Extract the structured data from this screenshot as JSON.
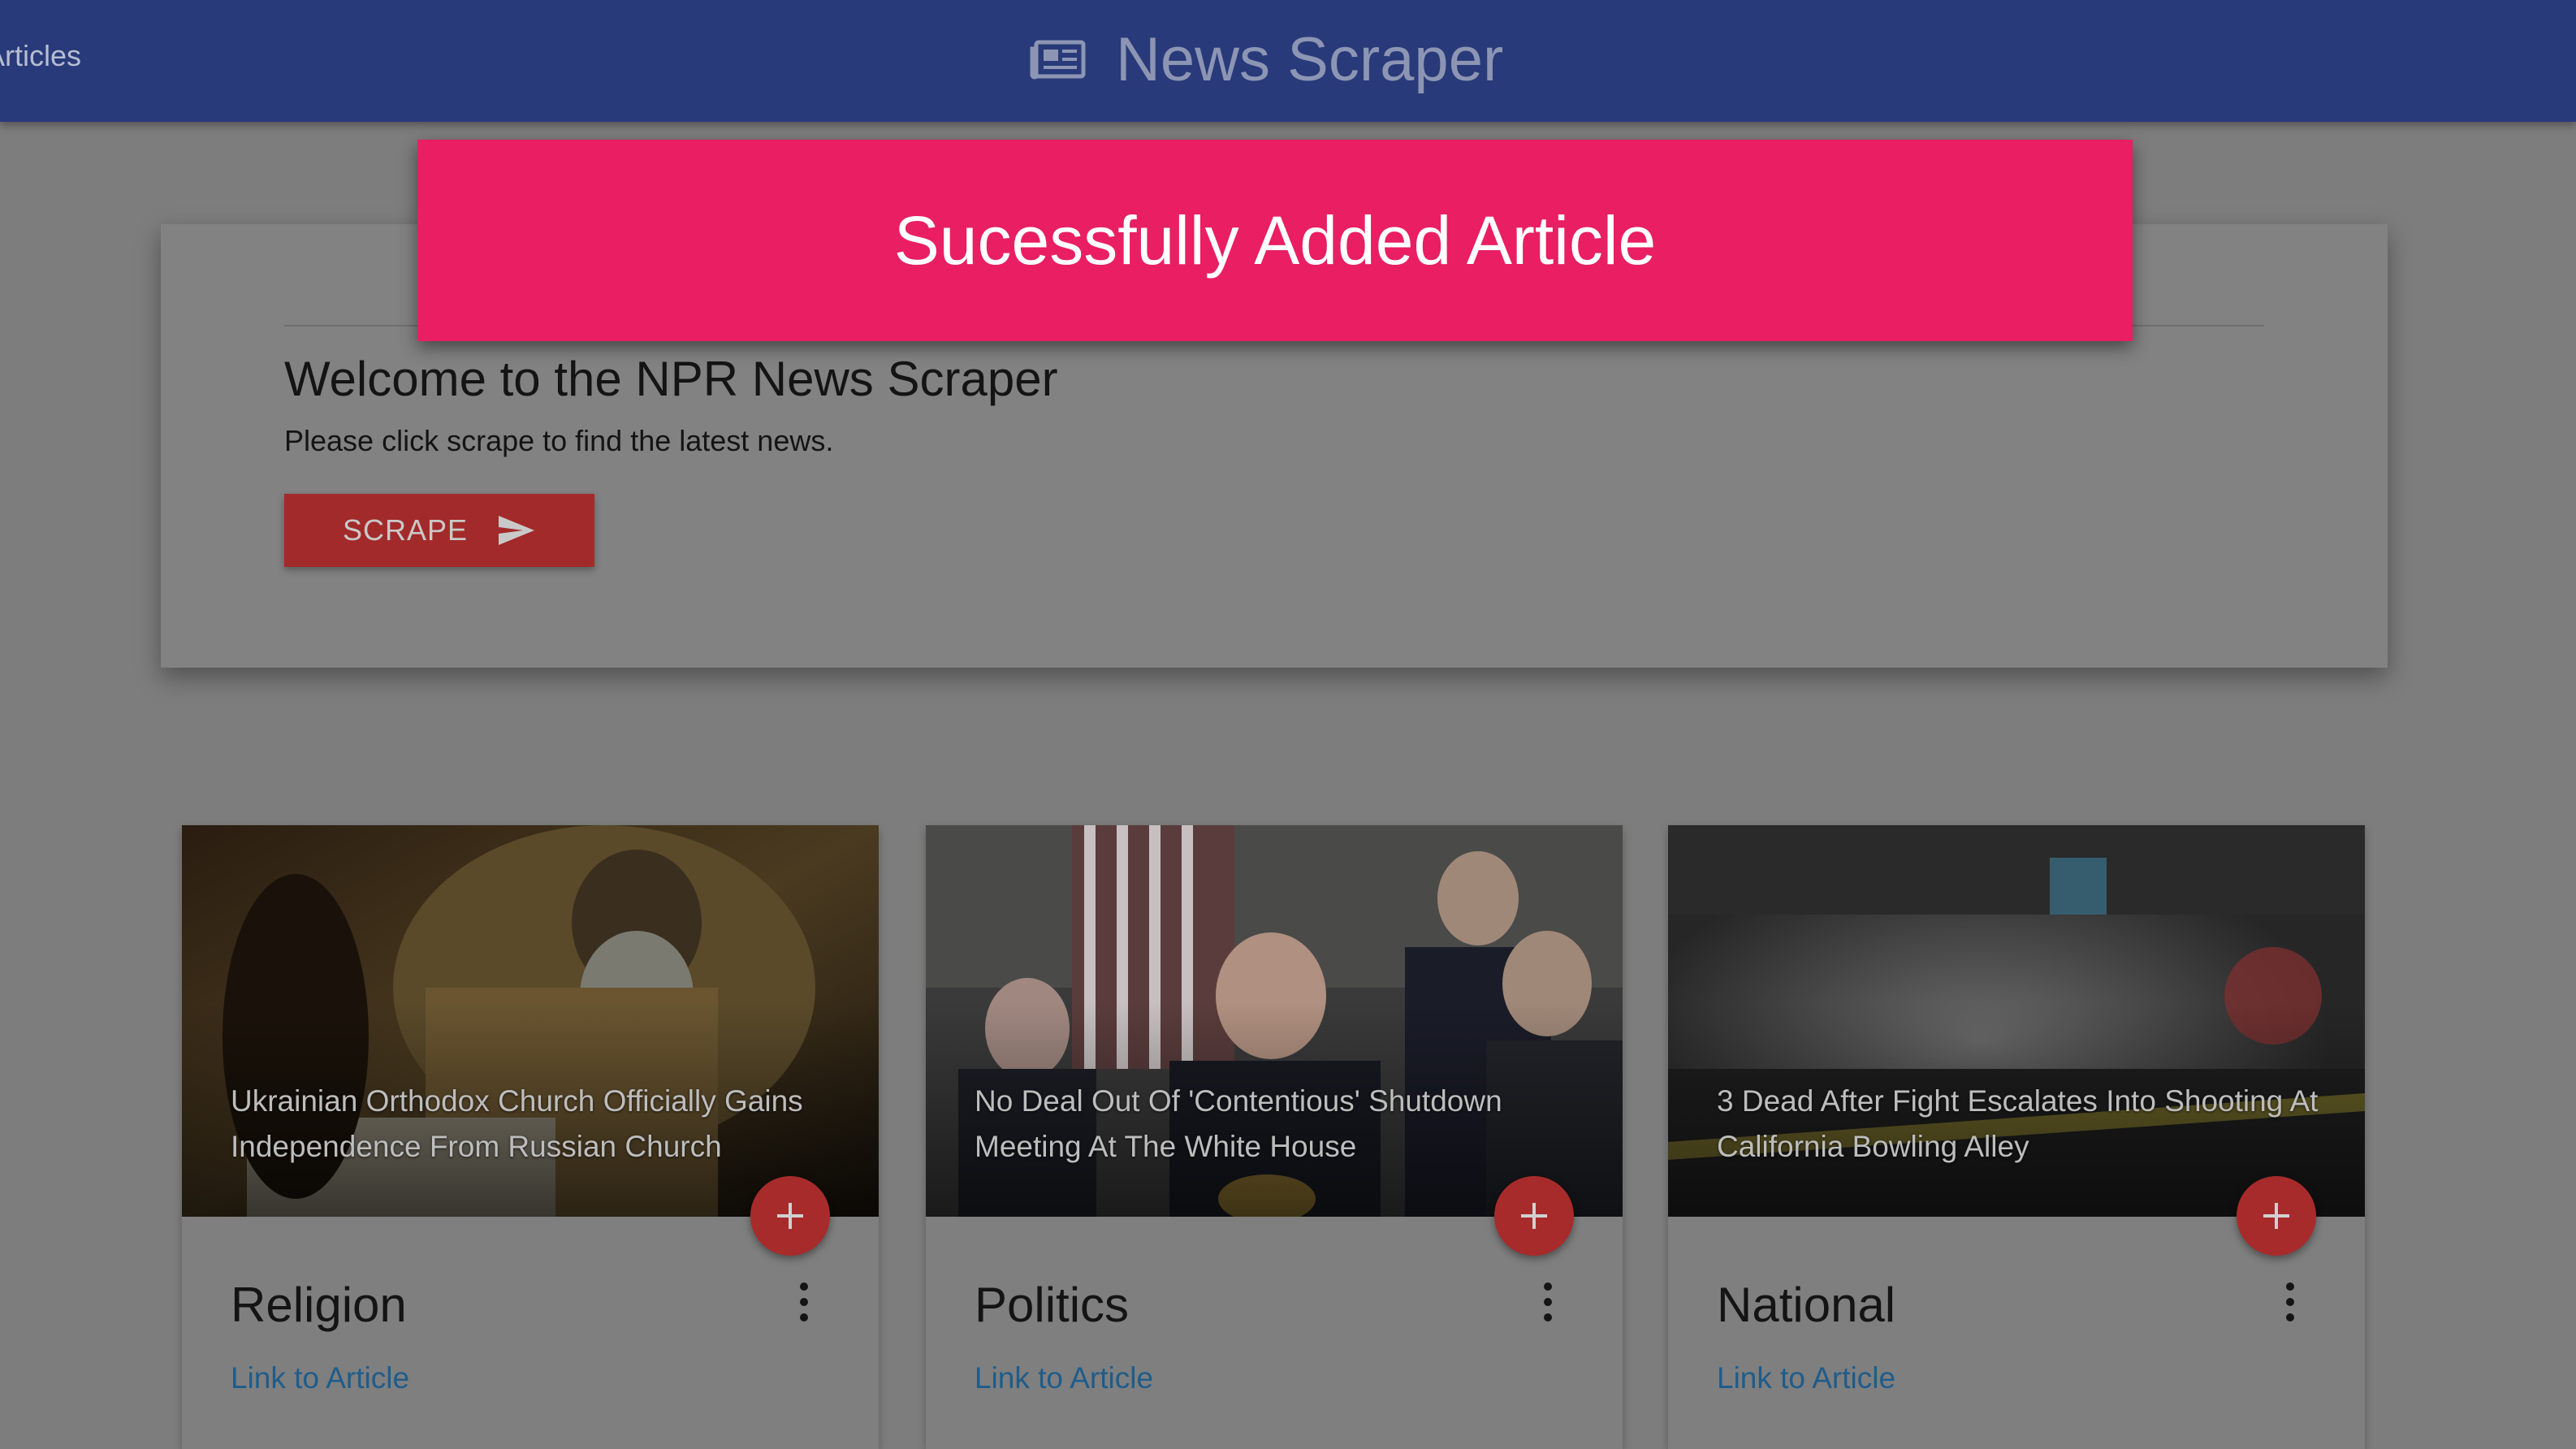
{
  "navbar": {
    "left_link": "Articles",
    "brand_icon": "newspaper-icon",
    "title": "News Scraper"
  },
  "toast": {
    "message": "Sucessfully Added Article"
  },
  "jumbotron": {
    "title": "Welcome to the NPR News Scraper",
    "subtitle": "Please click scrape to find the latest news.",
    "button_label": "SCRAPE",
    "button_icon": "send-icon"
  },
  "articles": [
    {
      "headline": "Ukrainian Orthodox Church Officially Gains Independence From Russian Church",
      "category": "Religion",
      "link_label": "Link to Article"
    },
    {
      "headline": "No Deal Out Of 'Contentious' Shutdown Meeting At The White House",
      "category": "Politics",
      "link_label": "Link to Article"
    },
    {
      "headline": "3 Dead After Fight Escalates Into Shooting At California Bowling Alley",
      "category": "National",
      "link_label": "Link to Article"
    }
  ],
  "colors": {
    "navbar": "#283a79",
    "toast": "#e91e63",
    "scrape_button": "#a32a2a",
    "fab": "#a82b2b",
    "link": "#1f5c8a"
  }
}
